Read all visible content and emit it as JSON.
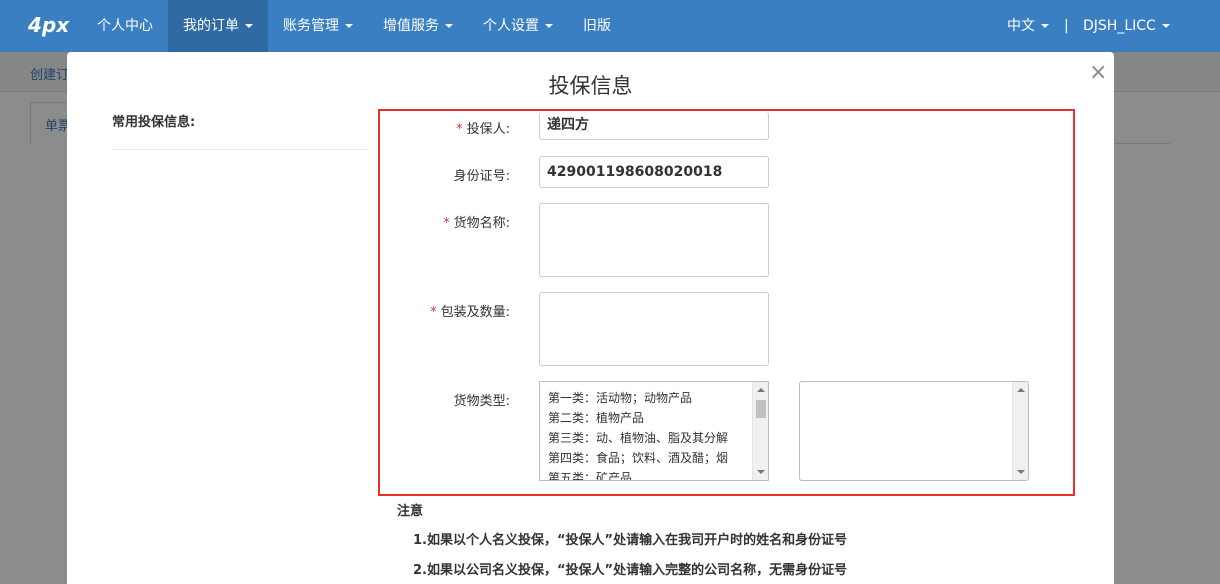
{
  "navbar": {
    "brand": "4px",
    "items": [
      {
        "label": "个人中心",
        "dropdown": false
      },
      {
        "label": "我的订单",
        "dropdown": true,
        "active": true
      },
      {
        "label": "账务管理",
        "dropdown": true
      },
      {
        "label": "增值服务",
        "dropdown": true
      },
      {
        "label": "个人设置",
        "dropdown": true
      },
      {
        "label": "旧版",
        "dropdown": false
      }
    ],
    "language": "中文",
    "separator": "|",
    "user": "DJSH_LICC",
    "colors": {
      "bar": "#3a7fc1",
      "active": "#2f6aa3"
    }
  },
  "background_page": {
    "breadcrumb": "创建订",
    "tab": "单票"
  },
  "modal": {
    "title": "投保信息",
    "close_glyph": "×",
    "sidebar_title": "常用投保信息:",
    "form": {
      "insured": {
        "label": "投保人:",
        "value": "递四方",
        "required": true
      },
      "id_number": {
        "label": "身份证号:",
        "value": "429001198608020018",
        "required": false
      },
      "goods_name": {
        "label": "货物名称:",
        "value": "",
        "required": true
      },
      "packing_qty": {
        "label": "包装及数量:",
        "value": "",
        "required": true
      },
      "goods_type": {
        "label": "货物类型:",
        "options": [
          "第一类：活动物；动物产品",
          "第二类：植物产品",
          "第三类：动、植物油、脂及其分解",
          "第四类：食品；饮料、酒及醋；烟",
          "第五类：矿产品"
        ],
        "selected_list": []
      }
    },
    "notice": {
      "title": "注意",
      "lines": [
        "1.如果以个人名义投保，“投保人”处请输入在我司开户时的姓名和身份证号",
        "2.如果以公司名义投保，“投保人”处请输入完整的公司名称，无需身份证号"
      ]
    },
    "highlight_color": "#e8302a"
  }
}
